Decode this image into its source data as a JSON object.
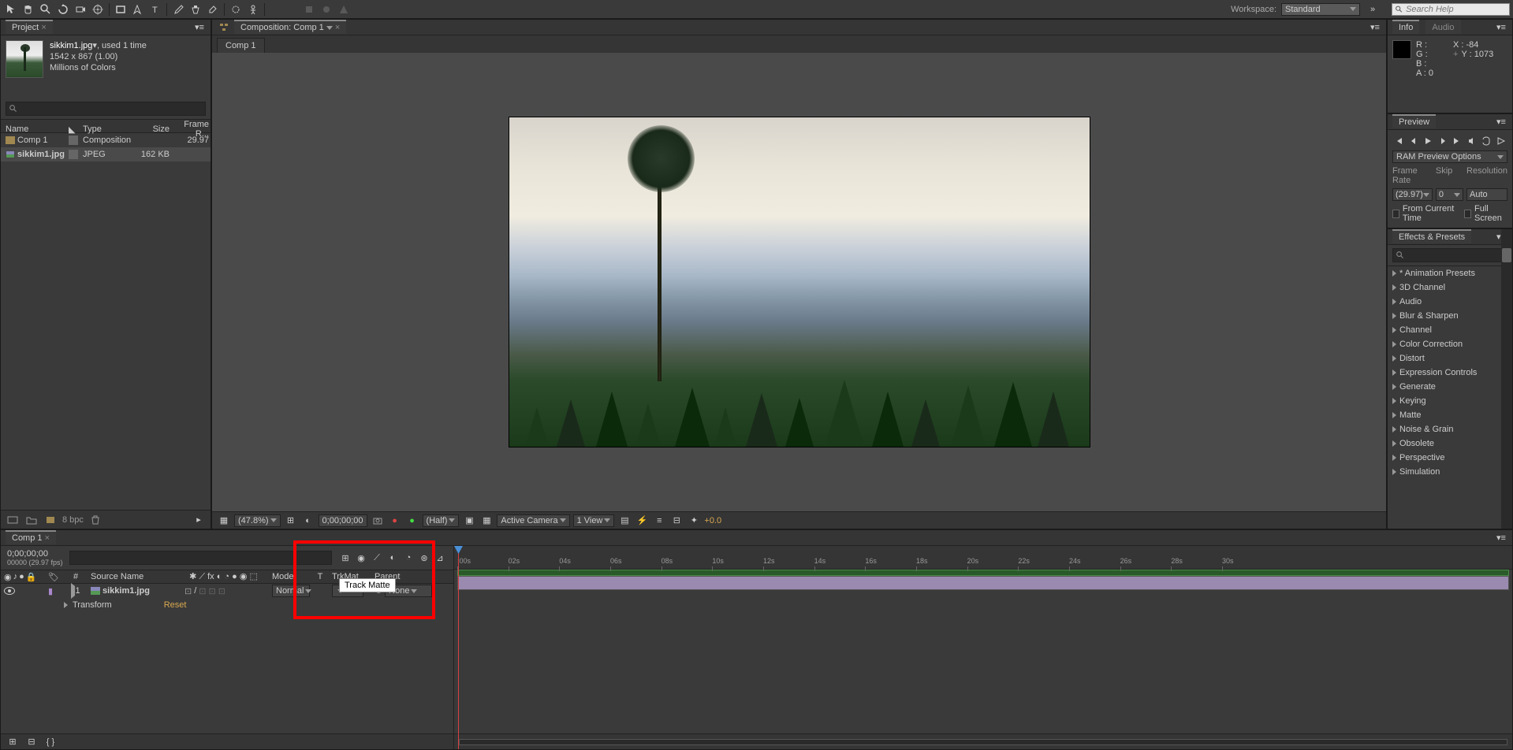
{
  "toolbar": {
    "workspace_label": "Workspace:",
    "workspace_value": "Standard",
    "search_placeholder": "Search Help"
  },
  "project": {
    "tab": "Project",
    "asset_name": "sikkim1.jpg",
    "used": ", used 1 time",
    "dims": "1542 x 867 (1.00)",
    "colors": "Millions of Colors",
    "head": {
      "name": "Name",
      "type": "Type",
      "size": "Size",
      "fr": "Frame R..."
    },
    "rows": [
      {
        "name": "Comp 1",
        "type": "Composition",
        "size": "",
        "fr": "29.97",
        "icon": "comp"
      },
      {
        "name": "sikkim1.jpg",
        "type": "JPEG",
        "size": "162 KB",
        "fr": "",
        "icon": "jpeg"
      }
    ],
    "bpc": "8 bpc"
  },
  "composition": {
    "tab_header": "Composition: Comp 1",
    "tab": "Comp 1",
    "zoom": "(47.8%)",
    "timecode": "0;00;00;00",
    "res": "(Half)",
    "camera": "Active Camera",
    "view": "1 View",
    "exposure": "+0.0"
  },
  "info": {
    "tab1": "Info",
    "tab2": "Audio",
    "r": "R :",
    "g": "G :",
    "b": "B :",
    "a": "A :  0",
    "x": "X : -84",
    "y": "Y :  1073"
  },
  "preview": {
    "tab": "Preview",
    "ram": "RAM Preview Options",
    "fr_label": "Frame Rate",
    "skip_label": "Skip",
    "res_label": "Resolution",
    "fr_val": "(29.97)",
    "skip_val": "0",
    "res_val": "Auto",
    "from_current": "From Current Time",
    "full": "Full Screen"
  },
  "effects": {
    "tab": "Effects & Presets",
    "items": [
      "* Animation Presets",
      "3D Channel",
      "Audio",
      "Blur & Sharpen",
      "Channel",
      "Color Correction",
      "Distort",
      "Expression Controls",
      "Generate",
      "Keying",
      "Matte",
      "Noise & Grain",
      "Obsolete",
      "Perspective",
      "Simulation"
    ]
  },
  "timeline": {
    "tab": "Comp 1",
    "timecode": "0;00;00;00",
    "timecode_sub": "00000 (29.97 fps)",
    "head": {
      "src": "Source Name",
      "mode": "Mode",
      "t": "T",
      "trkmat": "TrkMat",
      "parent": "Parent"
    },
    "layer": {
      "num": "1",
      "name": "sikkim1.jpg",
      "mode": "Normal",
      "parent": "None"
    },
    "prop": "Transform",
    "reset": "Reset",
    "ticks": [
      ":00s",
      "02s",
      "04s",
      "06s",
      "08s",
      "10s",
      "12s",
      "14s",
      "16s",
      "18s",
      "20s",
      "22s",
      "24s",
      "26s",
      "28s",
      "30s"
    ],
    "tooltip": "Track Matte"
  }
}
